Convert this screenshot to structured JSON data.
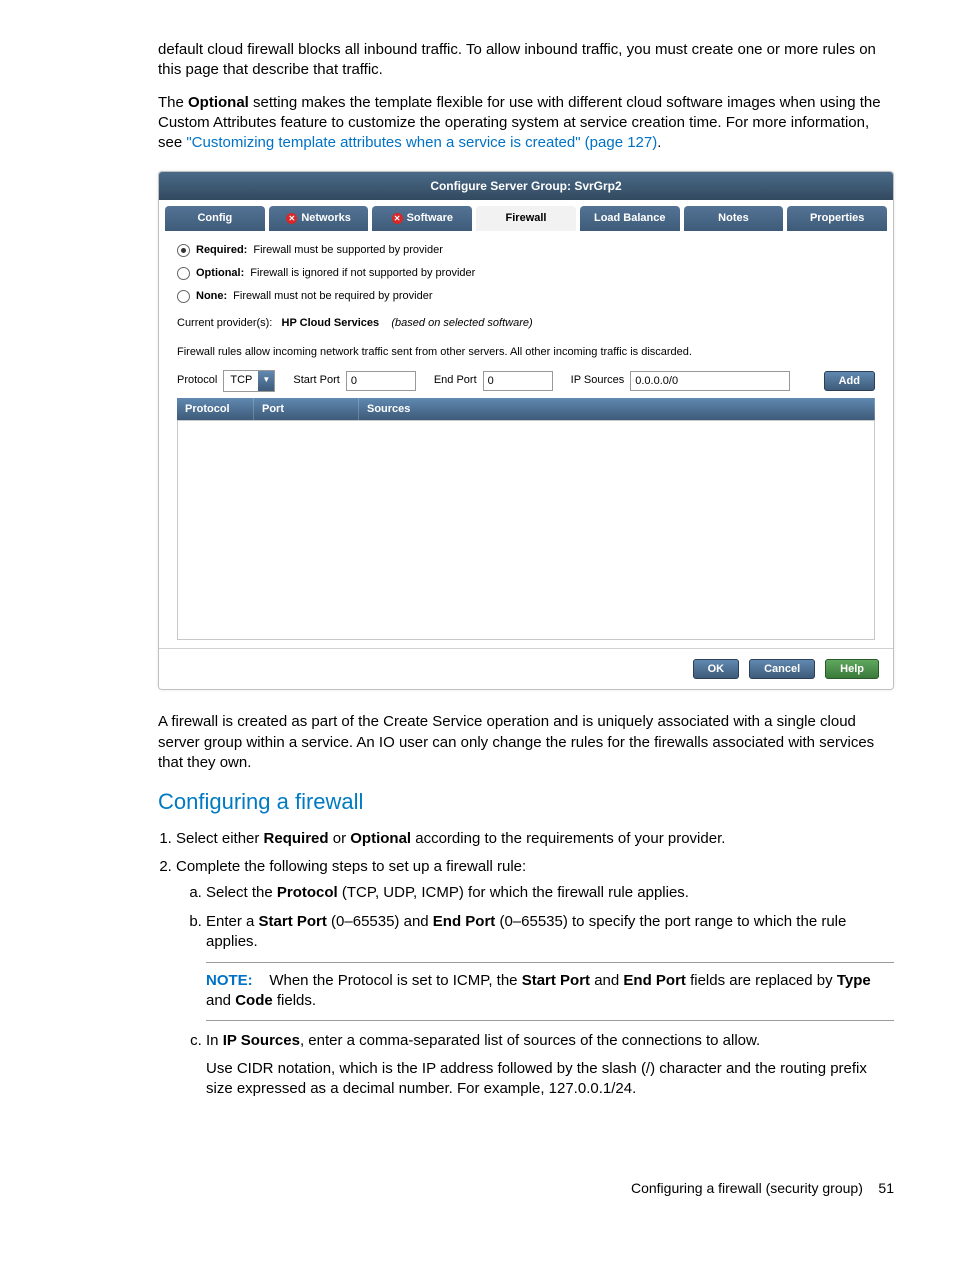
{
  "intro": {
    "p1": "default cloud firewall blocks all inbound traffic. To allow inbound traffic, you must create one or more rules on this page that describe that traffic.",
    "p2_a": "The ",
    "p2_b": "Optional",
    "p2_c": " setting makes the template flexible for use with different cloud software images when using the Custom Attributes feature to customize the operating system at service creation time. For more information, see ",
    "p2_link": "\"Customizing template attributes when a service is created\" (page 127)",
    "p2_d": "."
  },
  "dialog": {
    "title": "Configure Server Group: SvrGrp2",
    "tabs": {
      "config": "Config",
      "networks": "Networks",
      "software": "Software",
      "firewall": "Firewall",
      "loadbalance": "Load Balance",
      "notes": "Notes",
      "properties": "Properties"
    },
    "radios": {
      "required_label": "Required:",
      "required_desc": "Firewall must be supported by provider",
      "optional_label": "Optional:",
      "optional_desc": "Firewall is ignored if not supported by provider",
      "none_label": "None:",
      "none_desc": "Firewall must not be required by provider"
    },
    "provider": {
      "label": "Current provider(s):",
      "value": "HP Cloud Services",
      "hint": "(based on selected software)"
    },
    "rules_hint": "Firewall rules allow incoming network traffic sent from other servers.  All other incoming traffic is discarded.",
    "form": {
      "protocol_label": "Protocol",
      "protocol_value": "TCP",
      "start_port_label": "Start Port",
      "start_port_value": "0",
      "end_port_label": "End Port",
      "end_port_value": "0",
      "ip_sources_label": "IP Sources",
      "ip_sources_value": "0.0.0.0/0",
      "add": "Add"
    },
    "grid": {
      "protocol": "Protocol",
      "port": "Port",
      "sources": "Sources"
    },
    "buttons": {
      "ok": "OK",
      "cancel": "Cancel",
      "help": "Help"
    }
  },
  "after": {
    "p1": "A firewall is created as part of the Create Service operation and is uniquely associated with a single cloud server group within a service. An IO user can only change the rules for the firewalls associated with services that they own."
  },
  "section": {
    "title": "Configuring a firewall",
    "step1_a": "Select either ",
    "step1_b": "Required",
    "step1_c": " or ",
    "step1_d": "Optional",
    "step1_e": " according to the requirements of your provider.",
    "step2": "Complete the following steps to set up a firewall rule:",
    "sa_a": "Select the ",
    "sa_b": "Protocol",
    "sa_c": " (TCP, UDP, ICMP) for which the firewall rule applies.",
    "sb_a": "Enter a ",
    "sb_b": "Start Port",
    "sb_c": " (0–65535) and ",
    "sb_d": "End Port",
    "sb_e": " (0–65535) to specify the port range to which the rule applies.",
    "note_label": "NOTE:",
    "note_a": "When the Protocol is set to ICMP, the ",
    "note_b": "Start Port",
    "note_c": " and ",
    "note_d": "End Port",
    "note_e": " fields are replaced by ",
    "note_f": "Type",
    "note_g": " and ",
    "note_h": "Code",
    "note_i": " fields.",
    "sc_a": "In ",
    "sc_b": "IP Sources",
    "sc_c": ", enter a comma-separated list of sources of the connections to allow.",
    "sc_p": "Use CIDR notation, which is the IP address followed by the slash (/) character and the routing prefix size expressed as a decimal number. For example, 127.0.0.1/24."
  },
  "footer": {
    "text": "Configuring a firewall (security group)",
    "page": "51"
  }
}
